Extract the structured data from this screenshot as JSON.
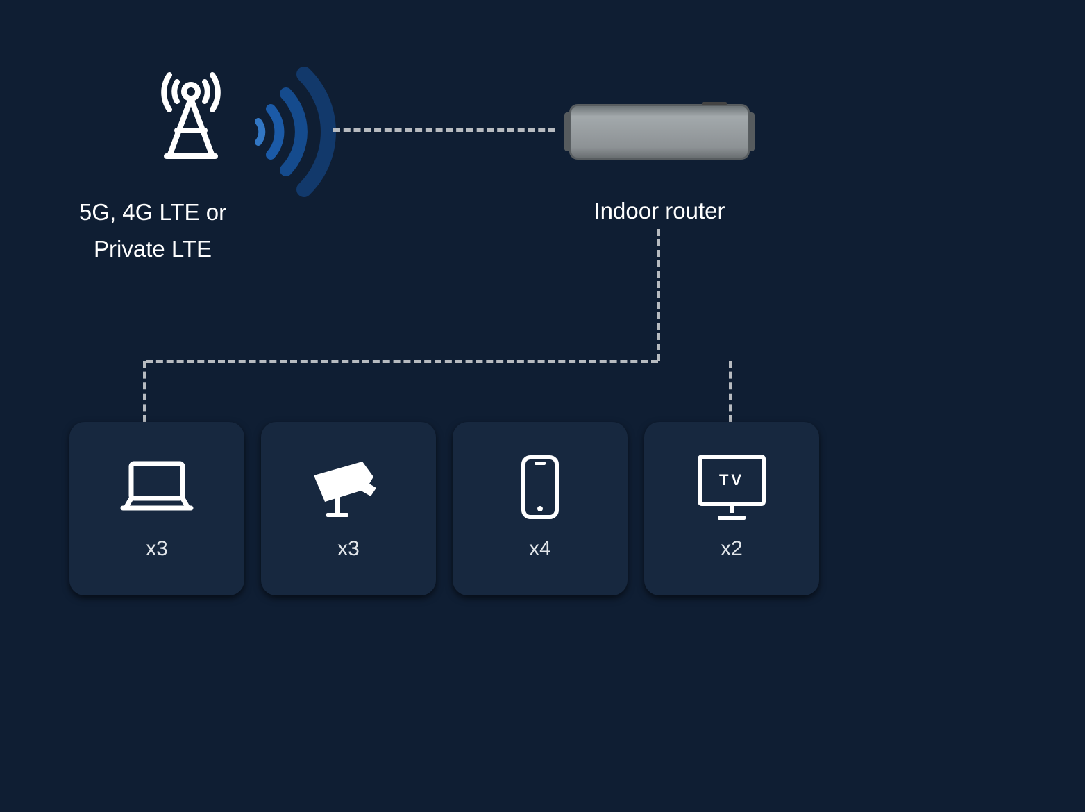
{
  "source": {
    "label_line1": "5G, 4G LTE or",
    "label_line2": "Private LTE"
  },
  "router": {
    "label": "Indoor router"
  },
  "devices": [
    {
      "name": "laptop",
      "count": "x3",
      "tv_text": ""
    },
    {
      "name": "camera",
      "count": "x3",
      "tv_text": ""
    },
    {
      "name": "phone",
      "count": "x4",
      "tv_text": ""
    },
    {
      "name": "tv",
      "count": "x2",
      "tv_text": "TV"
    }
  ],
  "colors": {
    "background": "#0f1e33",
    "card_bg": "#17283f",
    "accent_blue_dark": "#12396b",
    "accent_blue_mid": "#1b5aa7",
    "accent_blue_light": "#3277c4",
    "dash": "#b7bbc0",
    "icon": "#ffffff"
  }
}
